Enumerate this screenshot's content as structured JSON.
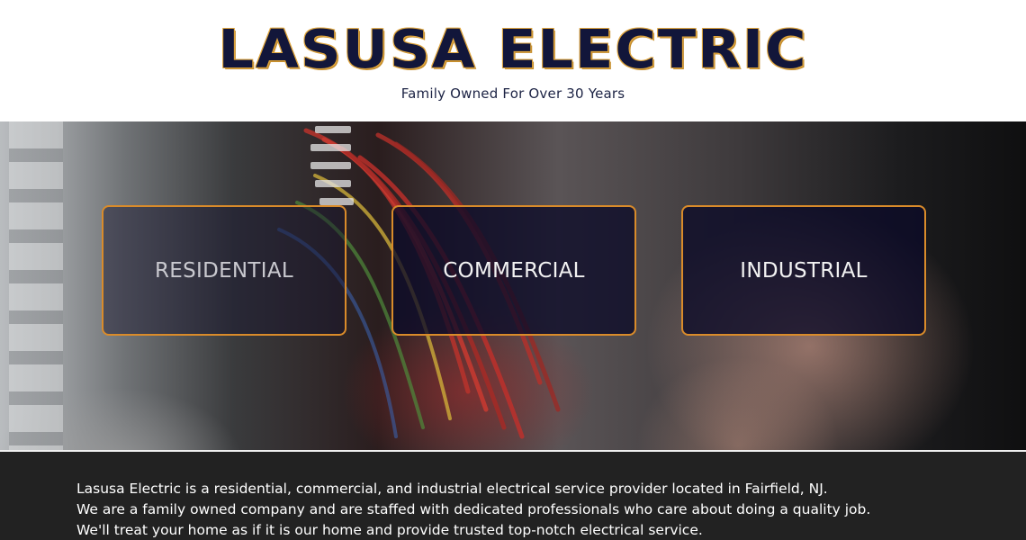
{
  "header": {
    "logo_text": "LASUSA ELECTRIC",
    "tagline": "Family Owned For Over 30 Years"
  },
  "hero": {
    "categories": [
      {
        "label": "RESIDENTIAL"
      },
      {
        "label": "COMMERCIAL"
      },
      {
        "label": "INDUSTRIAL"
      }
    ]
  },
  "about": {
    "lines": [
      "Lasusa Electric is a residential, commercial, and industrial electrical service provider located in Fairfield, NJ.",
      "We are a family owned company and are staffed with dedicated professionals who care about doing a quality job.",
      "We'll treat your home as if it is our home and provide trusted top-notch electrical service."
    ]
  },
  "colors": {
    "logo_fill": "#12163a",
    "logo_outline": "#e0a63d",
    "card_border": "#d98b2a",
    "card_background": "#0c0a28",
    "about_background": "#222222"
  }
}
